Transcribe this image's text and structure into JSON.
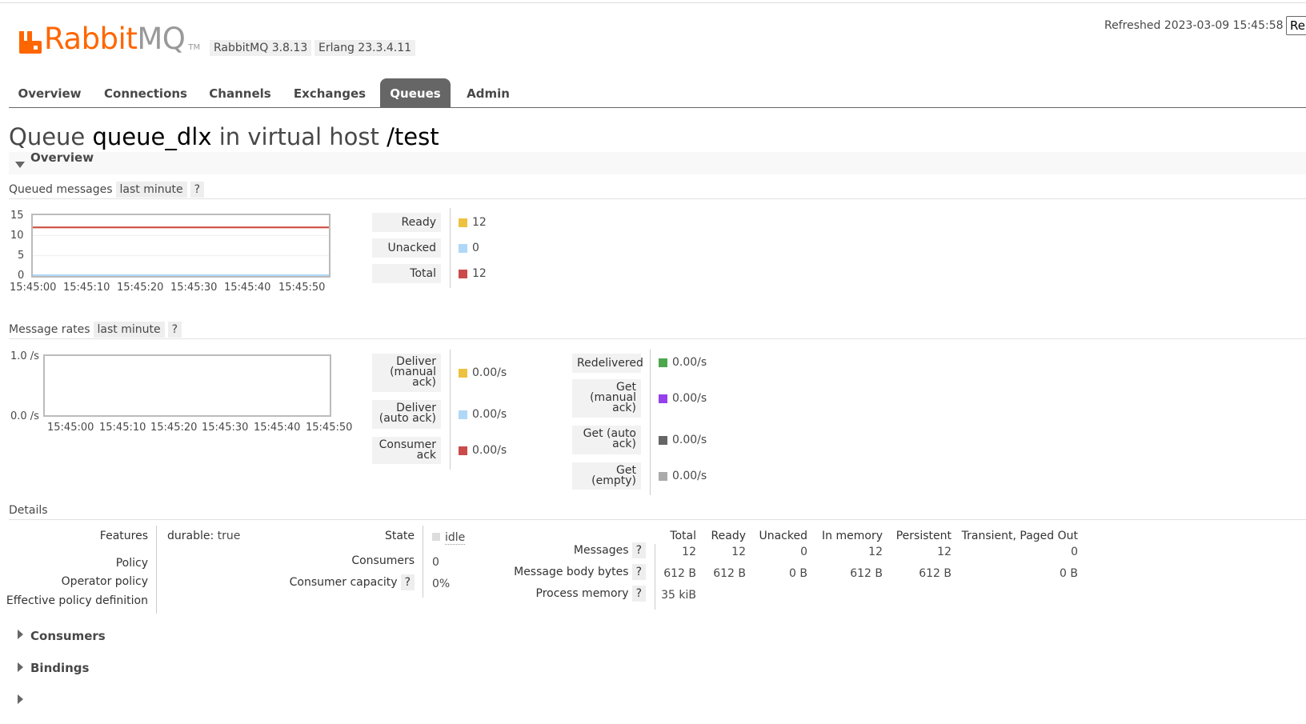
{
  "header": {
    "logo_text_a": "Rabbit",
    "logo_text_b": "MQ",
    "logo_tm": "TM",
    "version_rabbit": "RabbitMQ 3.8.13",
    "version_erlang": "Erlang 23.3.4.11",
    "refreshed": "Refreshed 2023-03-09 15:45:58",
    "refresh_button": "Re"
  },
  "nav": {
    "tabs": [
      {
        "label": "Overview"
      },
      {
        "label": "Connections"
      },
      {
        "label": "Channels"
      },
      {
        "label": "Exchanges"
      },
      {
        "label": "Queues"
      },
      {
        "label": "Admin"
      }
    ],
    "active": "Queues"
  },
  "title": {
    "prefix": "Queue",
    "queue_name": "queue_dlx",
    "middle": "in virtual host",
    "vhost": "/test"
  },
  "overview_section": {
    "label": "Overview"
  },
  "queued_messages": {
    "heading": "Queued messages",
    "range": "last minute",
    "help": "?",
    "y_ticks": [
      "15",
      "10",
      "5",
      "0"
    ],
    "x_ticks": [
      "15:45:00",
      "15:45:10",
      "15:45:20",
      "15:45:30",
      "15:45:40",
      "15:45:50"
    ],
    "legend": [
      {
        "label": "Ready",
        "value": "12",
        "color": "#edc240"
      },
      {
        "label": "Unacked",
        "value": "0",
        "color": "#afd8f8"
      },
      {
        "label": "Total",
        "value": "12",
        "color": "#cb4b4b"
      }
    ]
  },
  "message_rates": {
    "heading": "Message rates",
    "range": "last minute",
    "help": "?",
    "y_ticks": [
      "1.0 /s",
      "0.0 /s"
    ],
    "x_ticks": [
      "15:45:00",
      "15:45:10",
      "15:45:20",
      "15:45:30",
      "15:45:40",
      "15:45:50"
    ],
    "legend_left": [
      {
        "label": "Deliver (manual ack)",
        "value": "0.00/s",
        "color": "#edc240"
      },
      {
        "label": "Deliver (auto ack)",
        "value": "0.00/s",
        "color": "#afd8f8"
      },
      {
        "label": "Consumer ack",
        "value": "0.00/s",
        "color": "#cb4b4b"
      }
    ],
    "legend_right": [
      {
        "label": "Redelivered",
        "value": "0.00/s",
        "color": "#4da74d"
      },
      {
        "label": "Get (manual ack)",
        "value": "0.00/s",
        "color": "#9440ed"
      },
      {
        "label": "Get (auto ack)",
        "value": "0.00/s",
        "color": "#666666"
      },
      {
        "label": "Get (empty)",
        "value": "0.00/s",
        "color": "#aaaaaa"
      }
    ]
  },
  "chart_data": [
    {
      "type": "line",
      "title": "Queued messages",
      "x": [
        "15:45:00",
        "15:45:10",
        "15:45:20",
        "15:45:30",
        "15:45:40",
        "15:45:50"
      ],
      "ylim": [
        0,
        15
      ],
      "series": [
        {
          "name": "Ready",
          "values": [
            12,
            12,
            12,
            12,
            12,
            12
          ]
        },
        {
          "name": "Unacked",
          "values": [
            0,
            0,
            0,
            0,
            0,
            0
          ]
        },
        {
          "name": "Total",
          "values": [
            12,
            12,
            12,
            12,
            12,
            12
          ]
        }
      ]
    },
    {
      "type": "line",
      "title": "Message rates",
      "x": [
        "15:45:00",
        "15:45:10",
        "15:45:20",
        "15:45:30",
        "15:45:40",
        "15:45:50"
      ],
      "ylim": [
        0,
        1
      ],
      "series": []
    }
  ],
  "details": {
    "heading": "Details",
    "features_label": "Features",
    "features_key": "durable:",
    "features_value": "true",
    "policy_label": "Policy",
    "operator_policy_label": "Operator policy",
    "effective_policy_label": "Effective policy definition",
    "state_label": "State",
    "state_value": "idle",
    "consumers_label": "Consumers",
    "consumers_value": "0",
    "consumer_capacity_label": "Consumer capacity",
    "consumer_capacity_value": "0%",
    "help": "?",
    "columns": [
      "Total",
      "Ready",
      "Unacked",
      "In memory",
      "Persistent",
      "Transient, Paged Out"
    ],
    "rows": [
      {
        "label": "Messages",
        "values": [
          "12",
          "12",
          "0",
          "12",
          "12",
          "0"
        ]
      },
      {
        "label": "Message body bytes",
        "values": [
          "612 B",
          "612 B",
          "0 B",
          "612 B",
          "612 B",
          "0 B"
        ]
      },
      {
        "label": "Process memory",
        "values": [
          "35 kiB",
          "",
          "",
          "",
          "",
          ""
        ]
      }
    ]
  },
  "collapsed_sections": [
    {
      "label": "Consumers"
    },
    {
      "label": "Bindings"
    }
  ]
}
